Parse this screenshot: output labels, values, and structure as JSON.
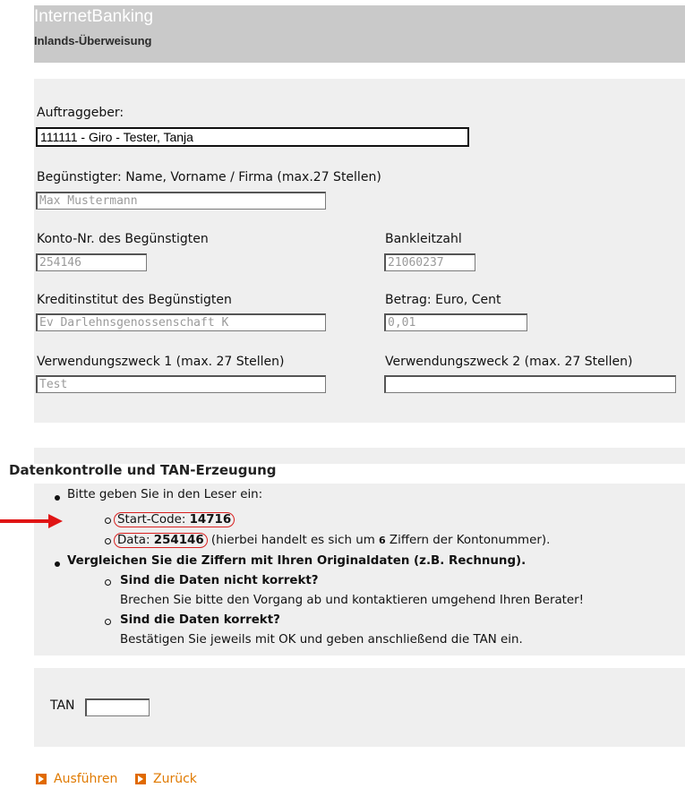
{
  "header": {
    "app_title": "InternetBanking",
    "page_title": "Inlands-Überweisung"
  },
  "form": {
    "auftraggeber_label": "Auftraggeber:",
    "auftraggeber_value": "111111 - Giro - Tester, Tanja",
    "beguenstigter_label": "Begünstigter: Name, Vorname / Firma (max.27 Stellen)",
    "beguenstigter_value": "Max Mustermann",
    "konto_label": "Konto-Nr. des Begünstigten",
    "konto_value": "254146",
    "blz_label": "Bankleitzahl",
    "blz_value": "21060237",
    "kreditinstitut_label": "Kreditinstitut des Begünstigten",
    "kreditinstitut_value": "Ev Darlehnsgenossenschaft K",
    "betrag_label": "Betrag: Euro, Cent",
    "betrag_value": "0,01",
    "zweck1_label": "Verwendungszweck 1 (max. 27 Stellen)",
    "zweck1_value": "Test",
    "zweck2_label": "Verwendungszweck 2 (max. 27 Stellen)",
    "zweck2_value": ""
  },
  "tan_section": {
    "title": "Datenkontrolle und TAN-Erzeugung",
    "instruction": "Bitte geben Sie in den Leser ein:",
    "start_code_label": "Start-Code: ",
    "start_code_value": "14716",
    "data_label": "Data: ",
    "data_value": "254146",
    "data_note_pre": " (hierbei handelt es sich um ",
    "data_note_count": "6",
    "data_note_post": " Ziffern der Kontonummer).",
    "compare": "Vergleichen Sie die Ziffern mit Ihren Originaldaten (z.B. Rechnung).",
    "incorrect_q": "Sind die Daten nicht korrekt?",
    "incorrect_a": "Brechen Sie bitte den Vorgang ab und kontaktieren umgehend Ihren Berater!",
    "correct_q": "Sind die Daten korrekt?",
    "correct_a": "Bestätigen Sie jeweils mit OK und geben anschließend die TAN ein."
  },
  "tan": {
    "label": "TAN",
    "value": ""
  },
  "actions": {
    "execute": "Ausführen",
    "back": "Zurück"
  },
  "colors": {
    "panel": "#efefef",
    "header": "#c9c9c9",
    "accent": "#e07a00",
    "highlight": "#d81f1f"
  }
}
